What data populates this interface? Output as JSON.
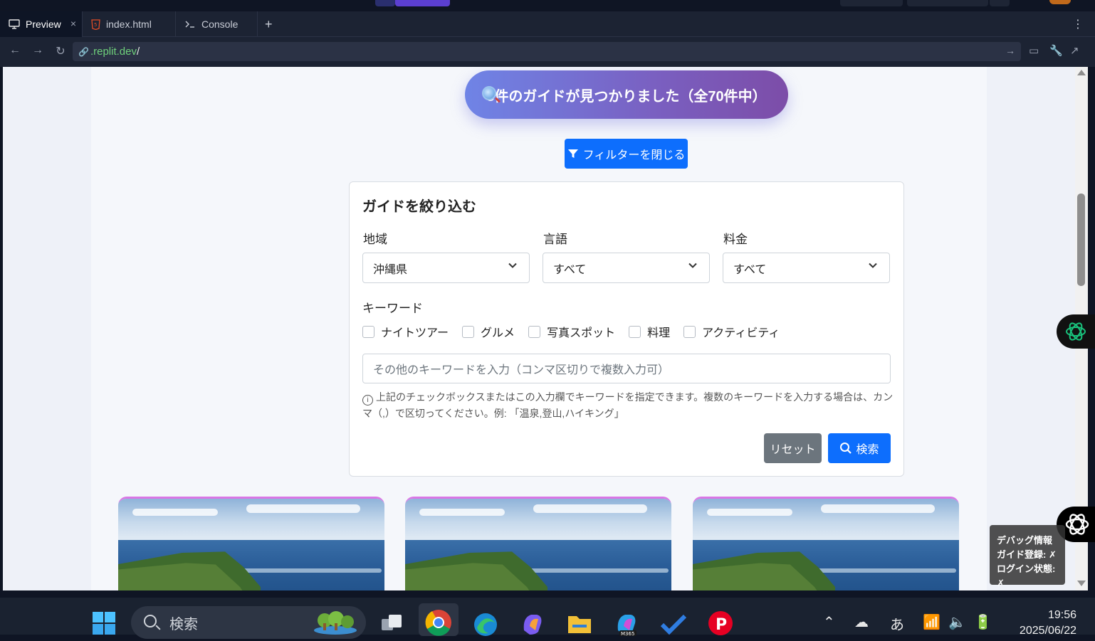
{
  "browser": {
    "tabs": [
      {
        "label": "Preview",
        "icon": "monitor-icon"
      },
      {
        "label": "index.html",
        "icon": "html5-icon"
      },
      {
        "label": "Console",
        "icon": "terminal-icon"
      }
    ],
    "close_glyph": "×",
    "add_glyph": "+",
    "url": {
      "domain": ".replit.dev",
      "path": "/"
    }
  },
  "page": {
    "results_text": "3件のガイドが見つかりました（全70件中）",
    "filter_toggle_label": "フィルターを閉じる",
    "panel": {
      "title": "ガイドを絞り込む",
      "region_label": "地域",
      "region_value": "沖縄県",
      "language_label": "言語",
      "language_value": "すべて",
      "price_label": "料金",
      "price_value": "すべて",
      "keyword_label": "キーワード",
      "keywords": [
        "ナイトツアー",
        "グルメ",
        "写真スポット",
        "料理",
        "アクティビティ"
      ],
      "keyword_placeholder": "その他のキーワードを入力（コンマ区切りで複数入力可）",
      "help_text": "上記のチェックボックスまたはこの入力欄でキーワードを指定できます。複数のキーワードを入力する場合は、カンマ（,）で区切ってください。例: 「温泉,登山,ハイキング」",
      "reset_label": "リセット",
      "search_label": "検索"
    },
    "cards": [
      {
        "image": "okinawa-cliff-seascape"
      },
      {
        "image": "okinawa-cliff-seascape"
      },
      {
        "image": "okinawa-cliff-seascape"
      }
    ],
    "debug": {
      "title": "デバッグ情報",
      "guide_registered": "ガイド登録: ✗",
      "login_state": "ログイン状態: ✗"
    }
  },
  "taskbar": {
    "search_placeholder": "検索",
    "ime": "あ",
    "time": "19:56",
    "date": "2025/06/22"
  },
  "colors": {
    "primary": "#0d6efd",
    "secondary": "#6c757d",
    "pill_start": "#6f84e6",
    "pill_end": "#7c4da8",
    "url_green": "#6fd17b"
  }
}
